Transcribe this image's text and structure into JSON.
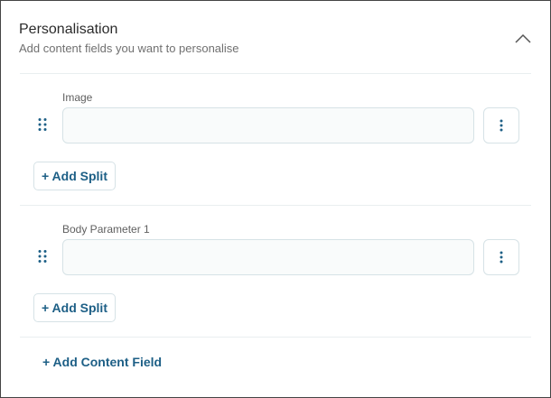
{
  "section": {
    "title": "Personalisation",
    "subtitle": "Add content fields you want to personalise",
    "collapse_icon": "chevron-up-icon"
  },
  "fields": [
    {
      "label": "Image",
      "value": "",
      "add_split_label": "+ Add Split"
    },
    {
      "label": "Body Parameter 1",
      "value": "",
      "add_split_label": "+ Add Split"
    }
  ],
  "add_content_field_label": "+ Add Content Field",
  "colors": {
    "accent": "#1d5f86",
    "border": "#d6e2e6",
    "divider": "#e9eef0"
  }
}
